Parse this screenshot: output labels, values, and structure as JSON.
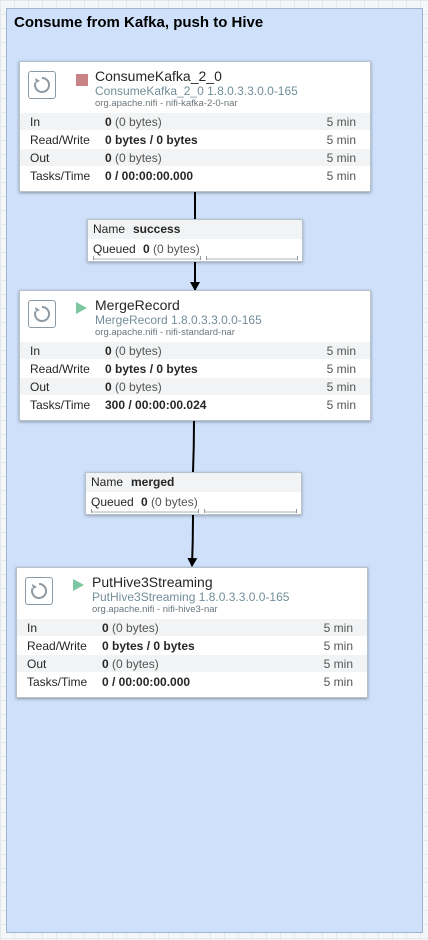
{
  "group": {
    "title": "Consume from Kafka, push to Hive"
  },
  "processors": [
    {
      "name": "ConsumeKafka_2_0",
      "type": "ConsumeKafka_2_0 1.8.0.3.3.0.0-165",
      "bundle": "org.apache.nifi - nifi-kafka-2-0-nar",
      "state": "stopped",
      "stats": {
        "in_label": "In",
        "in_count": "0",
        "in_bytes": "(0 bytes)",
        "in_time": "5 min",
        "rw_label": "Read/Write",
        "rw_value": "0 bytes / 0 bytes",
        "rw_time": "5 min",
        "out_label": "Out",
        "out_count": "0",
        "out_bytes": "(0 bytes)",
        "out_time": "5 min",
        "tasks_label": "Tasks/Time",
        "tasks_value": "0 / 00:00:00.000",
        "tasks_time": "5 min"
      }
    },
    {
      "name": "MergeRecord",
      "type": "MergeRecord 1.8.0.3.3.0.0-165",
      "bundle": "org.apache.nifi - nifi-standard-nar",
      "state": "running",
      "stats": {
        "in_label": "In",
        "in_count": "0",
        "in_bytes": "(0 bytes)",
        "in_time": "5 min",
        "rw_label": "Read/Write",
        "rw_value": "0 bytes / 0 bytes",
        "rw_time": "5 min",
        "out_label": "Out",
        "out_count": "0",
        "out_bytes": "(0 bytes)",
        "out_time": "5 min",
        "tasks_label": "Tasks/Time",
        "tasks_value": "300 / 00:00:00.024",
        "tasks_time": "5 min"
      }
    },
    {
      "name": "PutHive3Streaming",
      "type": "PutHive3Streaming 1.8.0.3.3.0.0-165",
      "bundle": "org.apache.nifi - nifi-hive3-nar",
      "state": "running",
      "stats": {
        "in_label": "In",
        "in_count": "0",
        "in_bytes": "(0 bytes)",
        "in_time": "5 min",
        "rw_label": "Read/Write",
        "rw_value": "0 bytes / 0 bytes",
        "rw_time": "5 min",
        "out_label": "Out",
        "out_count": "0",
        "out_bytes": "(0 bytes)",
        "out_time": "5 min",
        "tasks_label": "Tasks/Time",
        "tasks_value": "0 / 00:00:00.000",
        "tasks_time": "5 min"
      }
    }
  ],
  "connections": [
    {
      "name_label": "Name",
      "name": "success",
      "queued_label": "Queued",
      "queued_count": "0",
      "queued_bytes": "(0 bytes)"
    },
    {
      "name_label": "Name",
      "name": "merged",
      "queued_label": "Queued",
      "queued_count": "0",
      "queued_bytes": "(0 bytes)"
    }
  ],
  "colors": {
    "group_bg": "#cfe0fb",
    "stopped": "#c88387",
    "running": "#7dc7a0",
    "type_text": "#728e9b"
  },
  "icons": {
    "processor": "processor-icon",
    "stopped": "stop-icon",
    "running": "play-icon"
  }
}
